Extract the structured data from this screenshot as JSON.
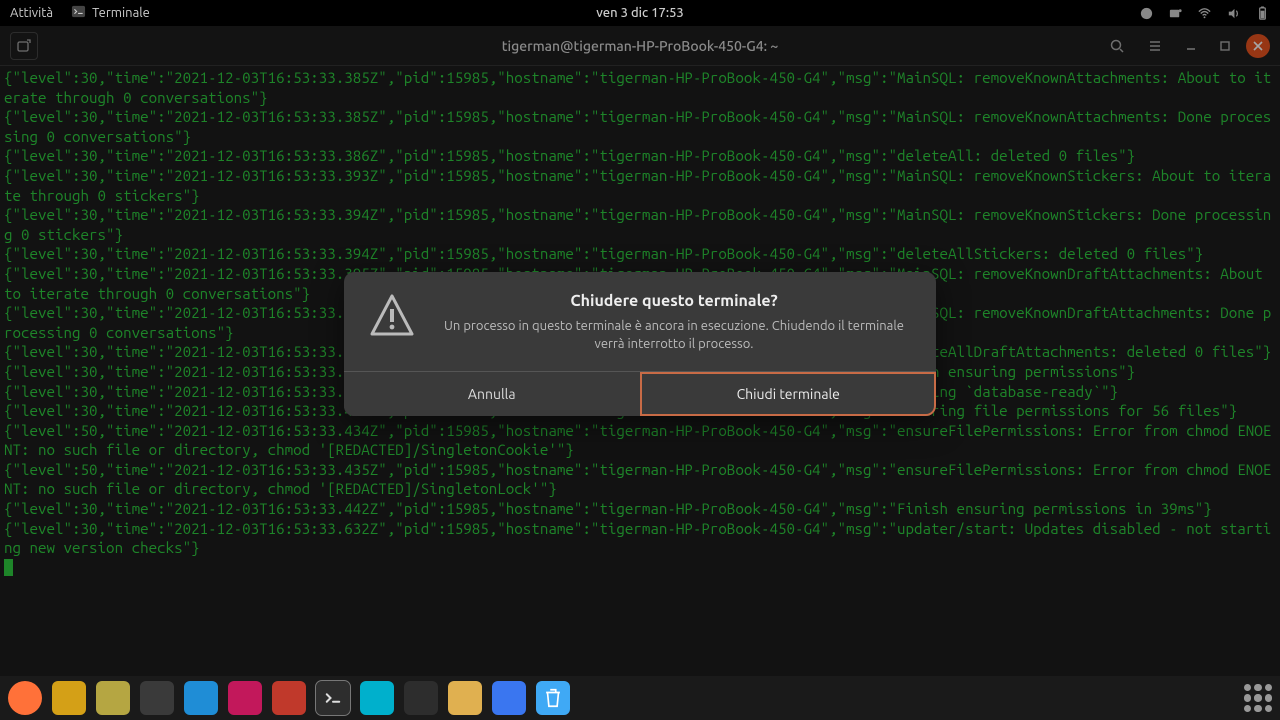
{
  "topbar": {
    "activities": "Attività",
    "app_name": "Terminale",
    "clock": "ven 3 dic  17:53"
  },
  "window": {
    "title": "tigerman@tigerman-HP-ProBook-450-G4: ~"
  },
  "terminal_lines": [
    "{\"level\":30,\"time\":\"2021-12-03T16:53:33.385Z\",\"pid\":15985,\"hostname\":\"tigerman-HP-ProBook-450-G4\",\"msg\":\"MainSQL: removeKnownAttachments: About to iterate through 0 conversations\"}",
    "{\"level\":30,\"time\":\"2021-12-03T16:53:33.385Z\",\"pid\":15985,\"hostname\":\"tigerman-HP-ProBook-450-G4\",\"msg\":\"MainSQL: removeKnownAttachments: Done processing 0 conversations\"}",
    "{\"level\":30,\"time\":\"2021-12-03T16:53:33.386Z\",\"pid\":15985,\"hostname\":\"tigerman-HP-ProBook-450-G4\",\"msg\":\"deleteAll: deleted 0 files\"}",
    "{\"level\":30,\"time\":\"2021-12-03T16:53:33.393Z\",\"pid\":15985,\"hostname\":\"tigerman-HP-ProBook-450-G4\",\"msg\":\"MainSQL: removeKnownStickers: About to iterate through 0 stickers\"}",
    "{\"level\":30,\"time\":\"2021-12-03T16:53:33.394Z\",\"pid\":15985,\"hostname\":\"tigerman-HP-ProBook-450-G4\",\"msg\":\"MainSQL: removeKnownStickers: Done processing 0 stickers\"}",
    "{\"level\":30,\"time\":\"2021-12-03T16:53:33.394Z\",\"pid\":15985,\"hostname\":\"tigerman-HP-ProBook-450-G4\",\"msg\":\"deleteAllStickers: deleted 0 files\"}",
    "{\"level\":30,\"time\":\"2021-12-03T16:53:33.395Z\",\"pid\":15985,\"hostname\":\"tigerman-HP-ProBook-450-G4\",\"msg\":\"MainSQL: removeKnownDraftAttachments: About to iterate through 0 conversations\"}",
    "{\"level\":30,\"time\":\"2021-12-03T16:53:33.395Z\",\"pid\":15985,\"hostname\":\"tigerman-HP-ProBook-450-G4\",\"msg\":\"MainSQL: removeKnownDraftAttachments: Done processing 0 conversations\"}",
    "{\"level\":30,\"time\":\"2021-12-03T16:53:33.396Z\",\"pid\":15985,\"hostname\":\"tigerman-HP-ProBook-450-G4\",\"msg\":\"deleteAllDraftAttachments: deleted 0 files\"}",
    "{\"level\":30,\"time\":\"2021-12-03T16:53:33.404Z\",\"pid\":15985,\"hostname\":\"tigerman-HP-ProBook-450-G4\",\"msg\":\"Begin ensuring permissions\"}",
    "{\"level\":30,\"time\":\"2021-12-03T16:53:33.404Z\",\"pid\":15985,\"hostname\":\"tigerman-HP-ProBook-450-G4\",\"msg\":\"sending `database-ready`\"}",
    "{\"level\":30,\"time\":\"2021-12-03T16:53:33.430Z\",\"pid\":15985,\"hostname\":\"tigerman-HP-ProBook-450-G4\",\"msg\":\"Ensuring file permissions for 56 files\"}",
    "{\"level\":50,\"time\":\"2021-12-03T16:53:33.434Z\",\"pid\":15985,\"hostname\":\"tigerman-HP-ProBook-450-G4\",\"msg\":\"ensureFilePermissions: Error from chmod ENOENT: no such file or directory, chmod '[REDACTED]/SingletonCookie'\"}",
    "{\"level\":50,\"time\":\"2021-12-03T16:53:33.435Z\",\"pid\":15985,\"hostname\":\"tigerman-HP-ProBook-450-G4\",\"msg\":\"ensureFilePermissions: Error from chmod ENOENT: no such file or directory, chmod '[REDACTED]/SingletonLock'\"}",
    "{\"level\":30,\"time\":\"2021-12-03T16:53:33.442Z\",\"pid\":15985,\"hostname\":\"tigerman-HP-ProBook-450-G4\",\"msg\":\"Finish ensuring permissions in 39ms\"}",
    "{\"level\":30,\"time\":\"2021-12-03T16:53:33.632Z\",\"pid\":15985,\"hostname\":\"tigerman-HP-ProBook-450-G4\",\"msg\":\"updater/start: Updates disabled - not starting new version checks\"}"
  ],
  "dialog": {
    "title": "Chiudere questo terminale?",
    "body": "Un processo in questo terminale è ancora in esecuzione. Chiudendo il terminale verrà interrotto il processo.",
    "cancel": "Annulla",
    "confirm": "Chiudi terminale"
  },
  "dock": {
    "items": [
      {
        "name": "firefox-icon",
        "bg": "#ff7139"
      },
      {
        "name": "app-amber-icon",
        "bg": "#d4a017"
      },
      {
        "name": "app-olive-icon",
        "bg": "#b5a642"
      },
      {
        "name": "settings-icon",
        "bg": "#3a3a3a"
      },
      {
        "name": "app-cyan-icon",
        "bg": "#1f8dd6"
      },
      {
        "name": "app-magenta-icon",
        "bg": "#c2185b"
      },
      {
        "name": "app-red-icon",
        "bg": "#c0392b"
      },
      {
        "name": "terminal-icon",
        "bg": "#2d2d2d"
      },
      {
        "name": "app-teal-icon",
        "bg": "#00b0cc"
      },
      {
        "name": "video-icon",
        "bg": "#2d2d2d"
      },
      {
        "name": "text-editor-icon",
        "bg": "#e0b050"
      },
      {
        "name": "signal-icon",
        "bg": "#3a76f0"
      },
      {
        "name": "trash-icon",
        "bg": "#3fa9f5"
      }
    ]
  }
}
